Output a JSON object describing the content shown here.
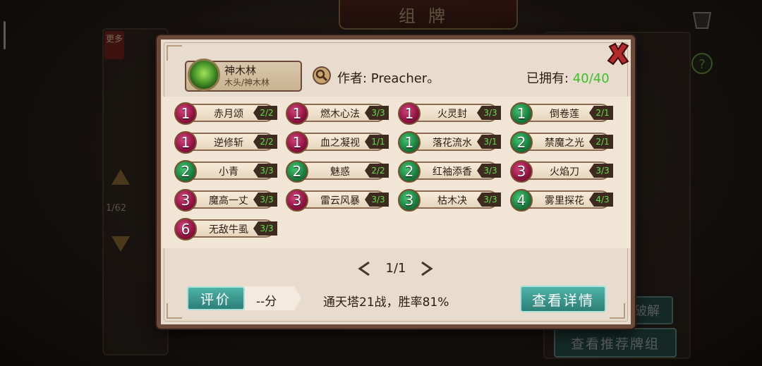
{
  "background": {
    "title": "组牌",
    "more_tab": "更多",
    "page_count": "1/62",
    "recommend_button": "查看推荐牌组",
    "solve_button": "破解"
  },
  "dialog": {
    "deck": {
      "name": "神木林",
      "type": "木头/神木林"
    },
    "author": "作者: Preacher。",
    "owned_label": "已拥有: ",
    "owned_value": "40/40",
    "cards": [
      {
        "cost": "1",
        "name": "赤月颂",
        "qty": "2/2",
        "element": "fire"
      },
      {
        "cost": "1",
        "name": "燃木心法",
        "qty": "3/3",
        "element": "fire"
      },
      {
        "cost": "1",
        "name": "火灵封",
        "qty": "3/3",
        "element": "fire"
      },
      {
        "cost": "1",
        "name": "倒卷莲",
        "qty": "2/1",
        "element": "wood"
      },
      {
        "cost": "1",
        "name": "逆修斩",
        "qty": "2/2",
        "element": "fire"
      },
      {
        "cost": "1",
        "name": "血之凝视",
        "qty": "1/1",
        "element": "fire"
      },
      {
        "cost": "1",
        "name": "落花流水",
        "qty": "3/1",
        "element": "wood"
      },
      {
        "cost": "2",
        "name": "禁魔之光",
        "qty": "2/1",
        "element": "wood"
      },
      {
        "cost": "2",
        "name": "小青",
        "qty": "3/3",
        "element": "wood"
      },
      {
        "cost": "2",
        "name": "魅惑",
        "qty": "2/2",
        "element": "wood"
      },
      {
        "cost": "2",
        "name": "红袖添香",
        "qty": "3/3",
        "element": "wood"
      },
      {
        "cost": "3",
        "name": "火焰刀",
        "qty": "3/3",
        "element": "fire"
      },
      {
        "cost": "3",
        "name": "魔高一丈",
        "qty": "3/3",
        "element": "fire"
      },
      {
        "cost": "3",
        "name": "雷云风暴",
        "qty": "3/3",
        "element": "fire"
      },
      {
        "cost": "3",
        "name": "枯木决",
        "qty": "3/3",
        "element": "wood"
      },
      {
        "cost": "4",
        "name": "雾里探花",
        "qty": "4/3",
        "element": "wood"
      },
      {
        "cost": "6",
        "name": "无敌牛虱",
        "qty": "3/3",
        "element": "fire"
      }
    ],
    "pager": "1/1",
    "rate_button": "评价",
    "score": "--分",
    "tower_stats": "通天塔21战，胜率81%",
    "detail_button": "查看详情"
  },
  "colors": {
    "owned_value": "#3cbf2b",
    "qty_text": "#5fe04a",
    "fire_orb": "#8f1140",
    "wood_orb": "#187a3d",
    "teal_button": "#2b7f77"
  }
}
